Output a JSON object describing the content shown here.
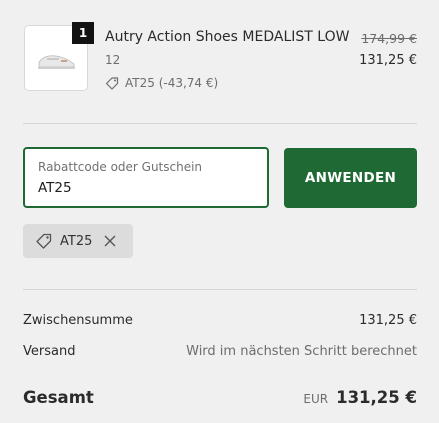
{
  "line_item": {
    "quantity": "1",
    "title": "Autry Action Shoes MEDALIST LOW",
    "variant": "12",
    "discount": "AT25 (-43,74 €)",
    "old_price": "174,99 €",
    "price": "131,25 €"
  },
  "discount_form": {
    "label": "Rabattcode oder Gutschein",
    "value": "AT25",
    "apply_label": "ANWENDEN"
  },
  "applied_code": "AT25",
  "totals": {
    "subtotal_label": "Zwischensumme",
    "subtotal_value": "131,25 €",
    "shipping_label": "Versand",
    "shipping_value": "Wird im nächsten Schritt berechnet",
    "total_label": "Gesamt",
    "currency": "EUR",
    "total_value": "131,25 €"
  },
  "colors": {
    "accent": "#1f6a34",
    "background": "#f0f0f0"
  }
}
